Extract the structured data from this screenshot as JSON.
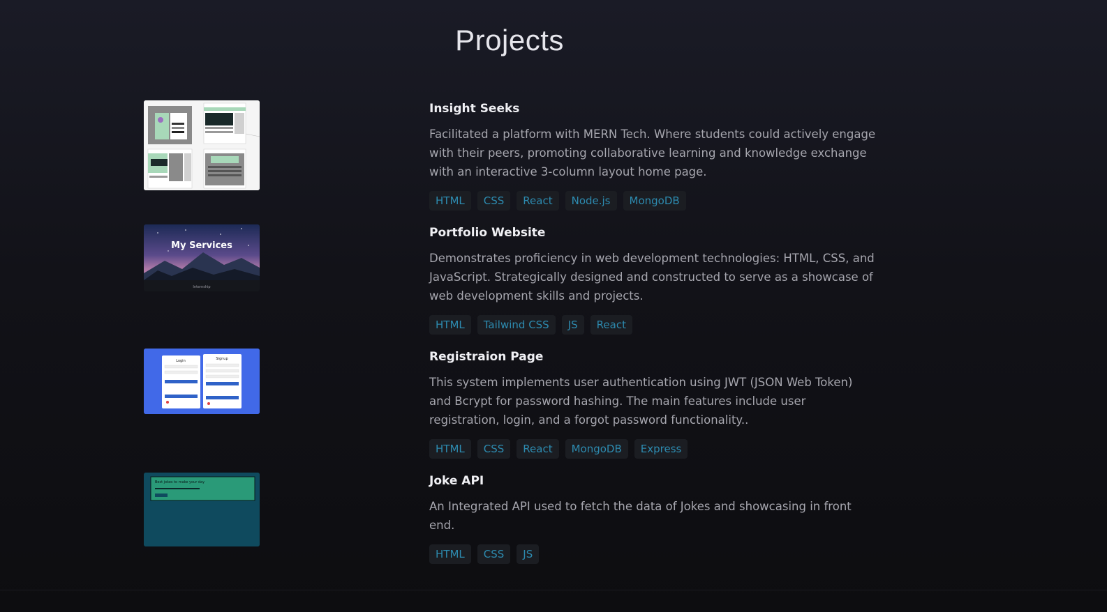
{
  "page": {
    "title": "Projects"
  },
  "projects": [
    {
      "title": "Insight Seeks",
      "description": "Facilitated a platform with MERN Tech. Where students could actively engage with their peers, promoting collaborative learning and knowledge exchange with an interactive 3-column layout home page.",
      "tags": [
        "HTML",
        "CSS",
        "React",
        "Node.js",
        "MongoDB"
      ]
    },
    {
      "title": "Portfolio Website",
      "description": "Demonstrates proficiency in web development technologies: HTML, CSS, and JavaScript. Strategically designed and constructed to serve as a showcase of web development skills and projects.",
      "tags": [
        "HTML",
        "Tailwind CSS",
        "JS",
        "React"
      ],
      "thumbnail_text": "My Services",
      "thumbnail_footer": "Internship"
    },
    {
      "title": "Registraion Page",
      "description": "This system implements user authentication using JWT (JSON Web Token) and Bcrypt for password hashing. The main features include user registration, login, and a forgot password functionality..",
      "tags": [
        "HTML",
        "CSS",
        "React",
        "MongoDB",
        "Express"
      ],
      "thumbnail_login": "Login",
      "thumbnail_signup": "Signup"
    },
    {
      "title": "Joke API",
      "description": "An Integrated API used to fetch the data of Jokes and showcasing in front end.",
      "tags": [
        "HTML",
        "CSS",
        "JS"
      ],
      "thumbnail_text": "Best jokes to make your day"
    }
  ],
  "colors": {
    "tag_text": "#2d8bb0",
    "tag_bg": "#1b1d22",
    "title": "#f0f0f4",
    "description": "#a6a6ae"
  }
}
